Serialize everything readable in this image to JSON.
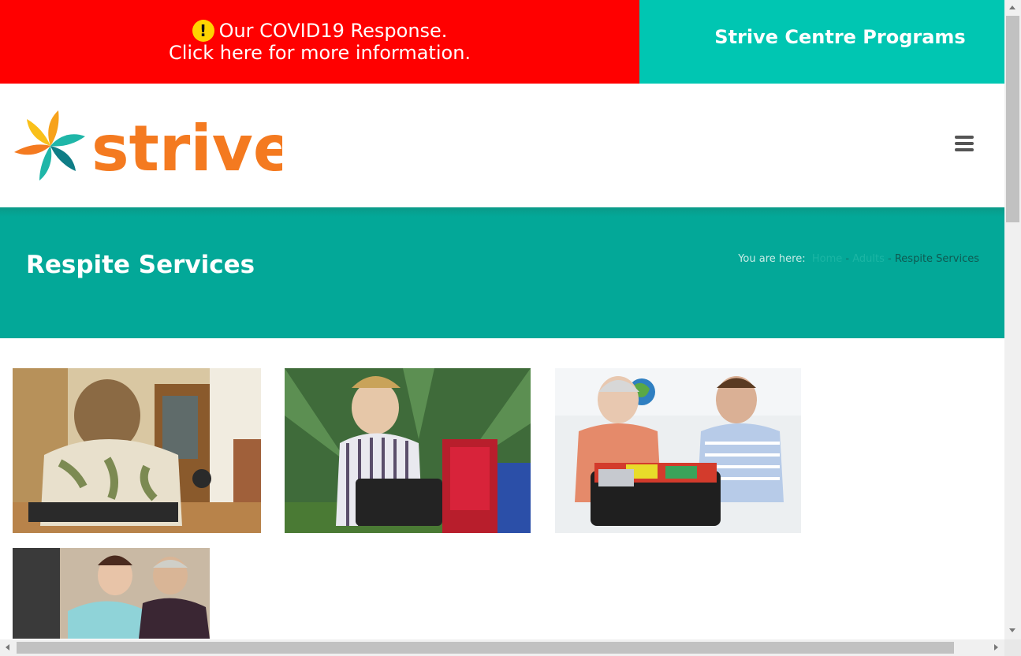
{
  "top_banner": {
    "covid_line1": "Our COVID19 Response.",
    "covid_line2": "Click here for more information.",
    "warning_icon": "exclamation-icon",
    "programs_label": "Strive Centre Programs"
  },
  "header": {
    "logo_text": "strive",
    "menu_icon": "hamburger-menu-icon"
  },
  "page": {
    "title": "Respite Services",
    "breadcrumb": {
      "prefix": "You are here:",
      "home": "Home",
      "separator": "-",
      "parent": "Adults",
      "current": "Respite Services"
    }
  },
  "colors": {
    "covid_red": "#ff0000",
    "programs_teal": "#00c6b2",
    "title_band": "#03a898",
    "logo_orange": "#f47a20"
  },
  "gallery": [
    {
      "name": "woman-in-wheelchair-photo"
    },
    {
      "name": "young-man-with-suitcase-photo"
    },
    {
      "name": "couple-packing-suitcase-photo"
    },
    {
      "name": "carer-with-patient-photo"
    }
  ]
}
